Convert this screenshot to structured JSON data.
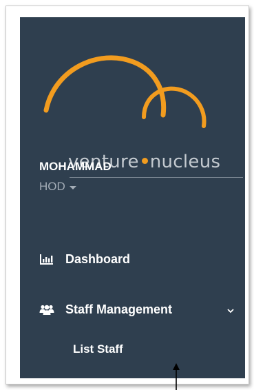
{
  "logo": {
    "text_left": "venture",
    "text_right": "nucleus",
    "accent_color": "#f29c1f"
  },
  "user": {
    "name": "MOHAMMAD",
    "role": "HOD"
  },
  "nav": {
    "dashboard": {
      "label": "Dashboard",
      "icon": "bar-chart-icon"
    },
    "staff_management": {
      "label": "Staff Management",
      "icon": "users-icon",
      "expanded": true,
      "children": [
        {
          "label": "List Staff"
        }
      ]
    }
  },
  "colors": {
    "sidebar_bg": "#2f3f4f",
    "text": "#ffffff",
    "muted_text": "#a4adb7"
  }
}
